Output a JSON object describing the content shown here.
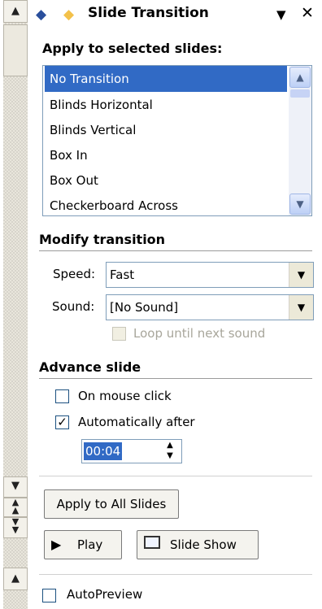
{
  "panel": {
    "title": "Slide Transition",
    "back_icon": "back-arrow-icon",
    "forward_icon": "forward-arrow-icon",
    "menu_icon": "dropdown-icon",
    "close_icon": "close-icon"
  },
  "apply": {
    "heading": "Apply to selected slides:",
    "items": [
      "No Transition",
      "Blinds Horizontal",
      "Blinds Vertical",
      "Box In",
      "Box Out",
      "Checkerboard Across"
    ],
    "selected": "No Transition"
  },
  "modify": {
    "heading": "Modify transition",
    "speed_label": "Speed:",
    "speed_value": "Fast",
    "sound_label": "Sound:",
    "sound_value": "[No Sound]",
    "loop_label": "Loop until next sound",
    "loop_checked": false
  },
  "advance": {
    "heading": "Advance slide",
    "on_click_label": "On mouse click",
    "on_click_checked": false,
    "auto_label": "Automatically after",
    "auto_checked": true,
    "auto_time": "00:04"
  },
  "buttons": {
    "apply_all": "Apply to All Slides",
    "play": "Play",
    "slide_show": "Slide Show"
  },
  "autopreview": {
    "label": "AutoPreview",
    "checked": false
  },
  "colors": {
    "selection": "#316ac5"
  }
}
